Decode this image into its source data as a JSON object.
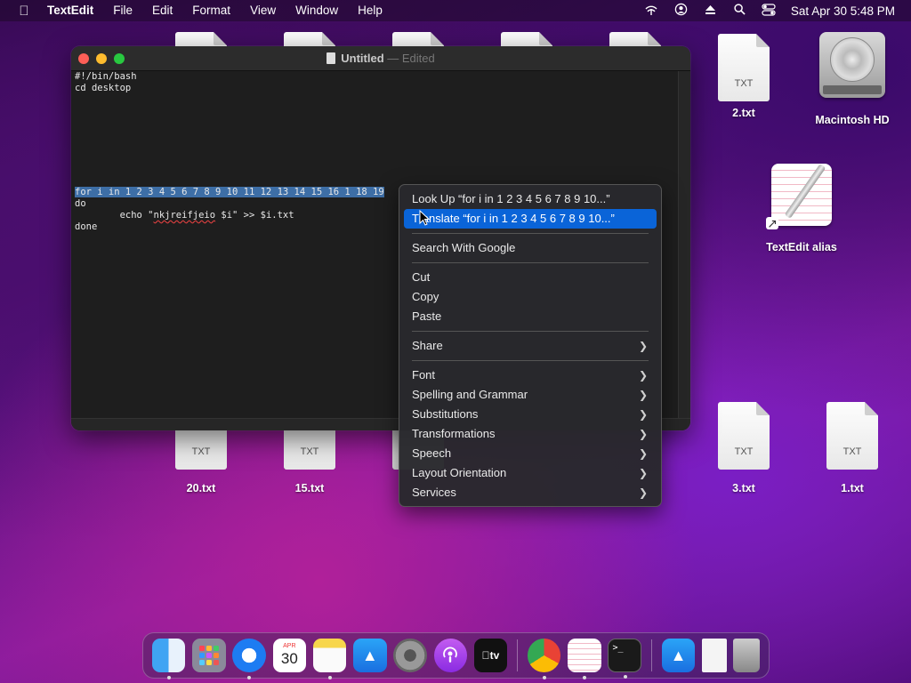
{
  "menubar": {
    "app_name": "TextEdit",
    "items": [
      "File",
      "Edit",
      "Format",
      "View",
      "Window",
      "Help"
    ],
    "clock": "Sat Apr 30  5:48 PM"
  },
  "window": {
    "title": "Untitled",
    "status": "Edited",
    "lines": [
      "#!/bin/bash",
      "cd desktop",
      "",
      "",
      "",
      "",
      "",
      "",
      "",
      "",
      "for i in 1 2 3 4 5 6 7 8 9 10 11 12 13 14 15 16 1 18 19",
      "do",
      "        echo \"nkjreifjeio $i\" >> $i.txt",
      "done"
    ],
    "echo_prefix": "        echo \"",
    "echo_misspelled": "nkjreifjeio",
    "echo_suffix": " $i\" >> $i.txt"
  },
  "context_menu": {
    "look_up": "Look Up “for i in 1 2 3 4 5 6 7 8 9 10...”",
    "translate": "Translate “for i in 1 2 3 4 5 6 7 8 9 10...”",
    "search_google": "Search With Google",
    "cut": "Cut",
    "copy": "Copy",
    "paste": "Paste",
    "share": "Share",
    "font": "Font",
    "spelling": "Spelling and Grammar",
    "substitutions": "Substitutions",
    "transformations": "Transformations",
    "speech": "Speech",
    "layout_orientation": "Layout Orientation",
    "services": "Services"
  },
  "desktop": {
    "file_type": "TXT",
    "file_2": "2.txt",
    "macintosh_hd": "Macintosh HD",
    "textedit_alias": "TextEdit alias",
    "file_20": "20.txt",
    "file_15": "15.txt",
    "file_3": "3.txt",
    "file_1": "1.txt"
  },
  "dock": {
    "calendar_month": "APR",
    "calendar_day": "30",
    "tv_label": "tv"
  },
  "colors": {
    "selection": "#3d6ea6",
    "menu_highlight": "#0a64d8"
  }
}
